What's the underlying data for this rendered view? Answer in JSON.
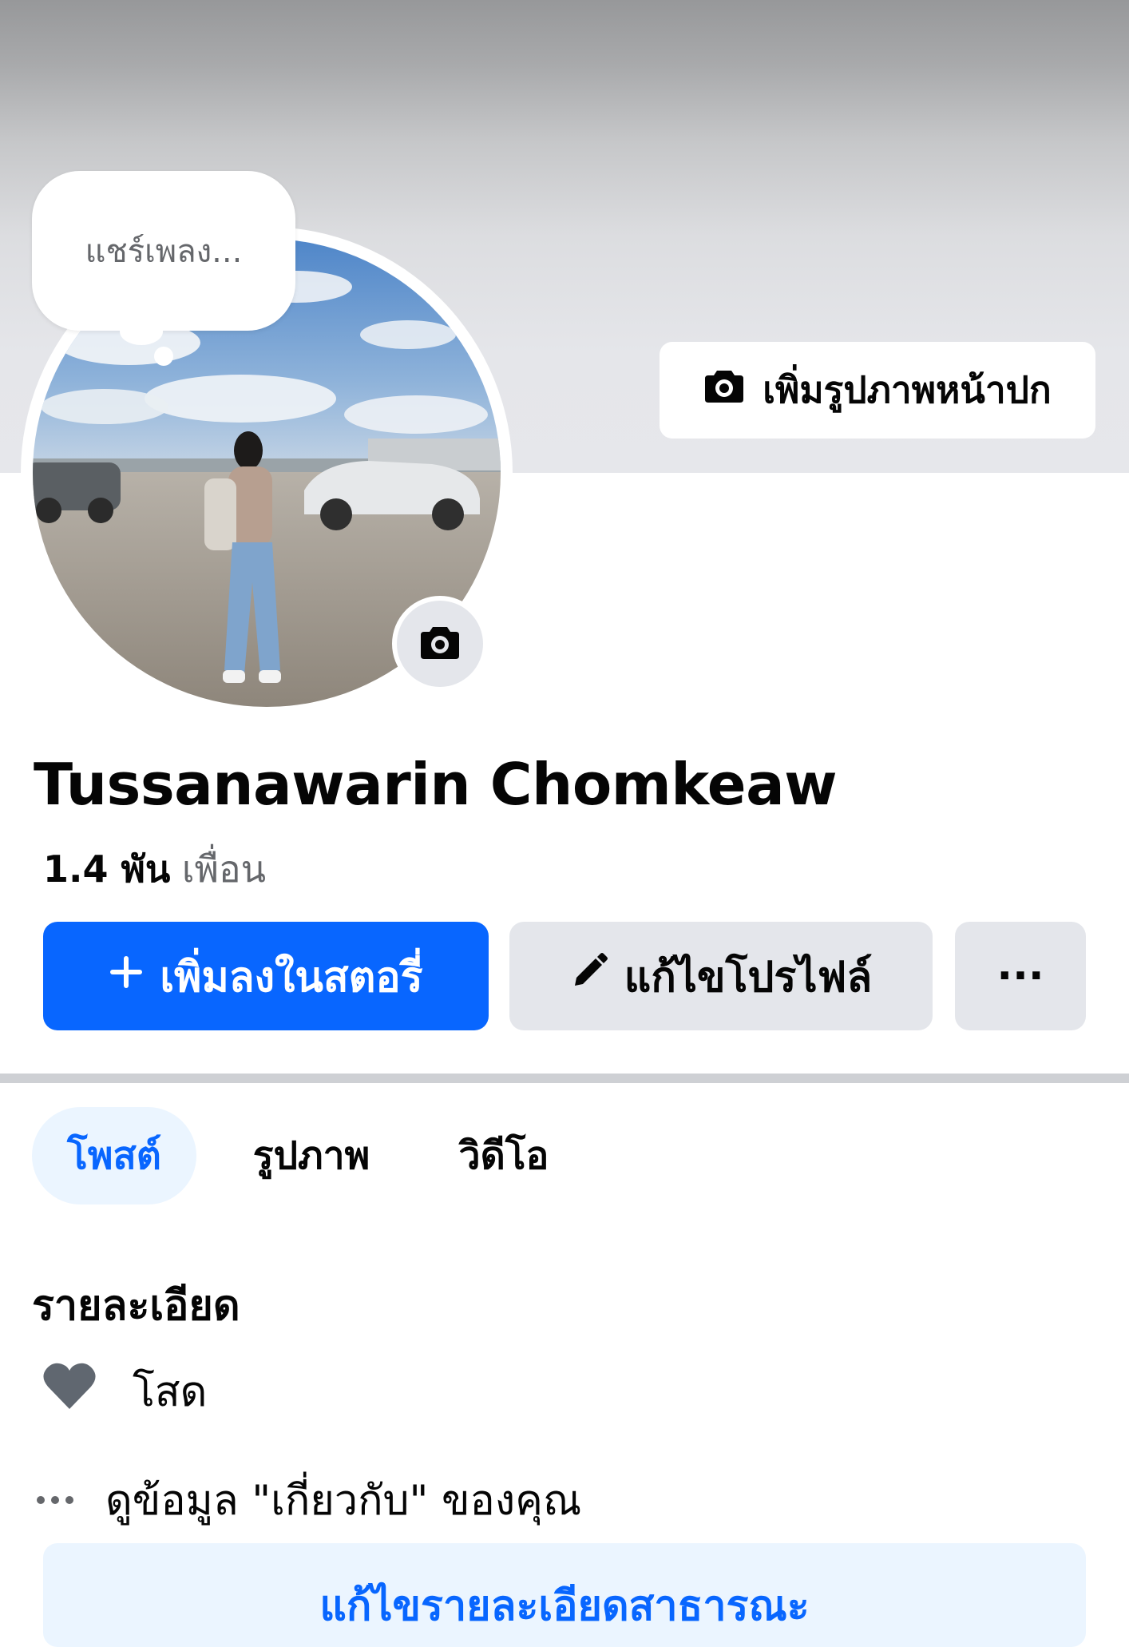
{
  "cover": {
    "add_cover_label": "เพิ่มรูปภาพหน้าปก",
    "icon": "camera-icon"
  },
  "profile": {
    "note_placeholder": "แชร์เพลง...",
    "name": "Tussanawarin Chomkeaw",
    "friends_count": "1.4 พัน",
    "friends_label": "เพื่อน",
    "avatar_camera_icon": "camera-icon"
  },
  "actions": {
    "add_story_label": "เพิ่มลงในสตอรี่",
    "add_story_icon": "plus-icon",
    "edit_profile_label": "แก้ไขโปรไฟล์",
    "edit_profile_icon": "pencil-icon",
    "more_label": "···"
  },
  "tabs": [
    {
      "label": "โพสต์",
      "active": true
    },
    {
      "label": "รูปภาพ",
      "active": false
    },
    {
      "label": "วิดีโอ",
      "active": false
    }
  ],
  "details": {
    "title": "รายละเอียด",
    "relationship": "โสด",
    "relationship_icon": "heart-icon",
    "about_link": "ดูข้อมูล \"เกี่ยวกับ\" ของคุณ",
    "about_icon": "more-dots-icon",
    "edit_public_label": "แก้ไขรายละเอียดสาธารณะ"
  },
  "colors": {
    "accent": "#0866ff",
    "secondary_button": "#e4e6eb",
    "active_tab_bg": "#ebf5ff",
    "muted_text": "#65676b"
  }
}
